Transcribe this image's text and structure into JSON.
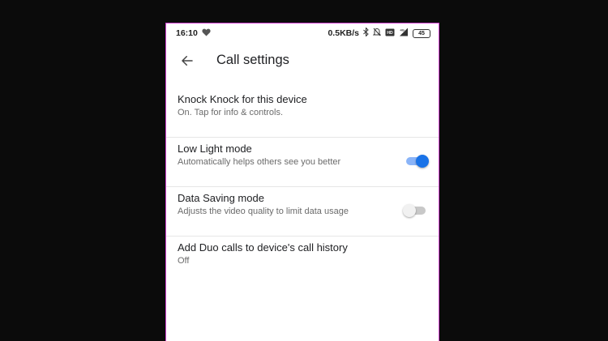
{
  "status_bar": {
    "time": "16:10",
    "network_speed": "0.5KB/s",
    "battery_level": "45",
    "icons": [
      "heart-icon",
      "bluetooth-icon",
      "mute-icon",
      "volte-icon",
      "signal-4g-icon",
      "battery-icon"
    ]
  },
  "toolbar": {
    "title": "Call settings",
    "back_icon": "arrow-left-icon"
  },
  "settings": [
    {
      "title": "Knock Knock for this device",
      "subtitle": "On. Tap for info & controls."
    },
    {
      "title": "Low Light mode",
      "subtitle": "Automatically helps others see you better",
      "toggle": "on"
    },
    {
      "title": "Data Saving mode",
      "subtitle": "Adjusts the video quality to limit data usage",
      "toggle": "off"
    },
    {
      "title": "Add Duo calls to device's call history",
      "subtitle": "Off"
    }
  ],
  "colors": {
    "accent": "#1a73e8",
    "accent_track": "#8ab4f8",
    "background": "#0b0b0b",
    "screen": "#ffffff",
    "frame_border": "#d040d0"
  }
}
